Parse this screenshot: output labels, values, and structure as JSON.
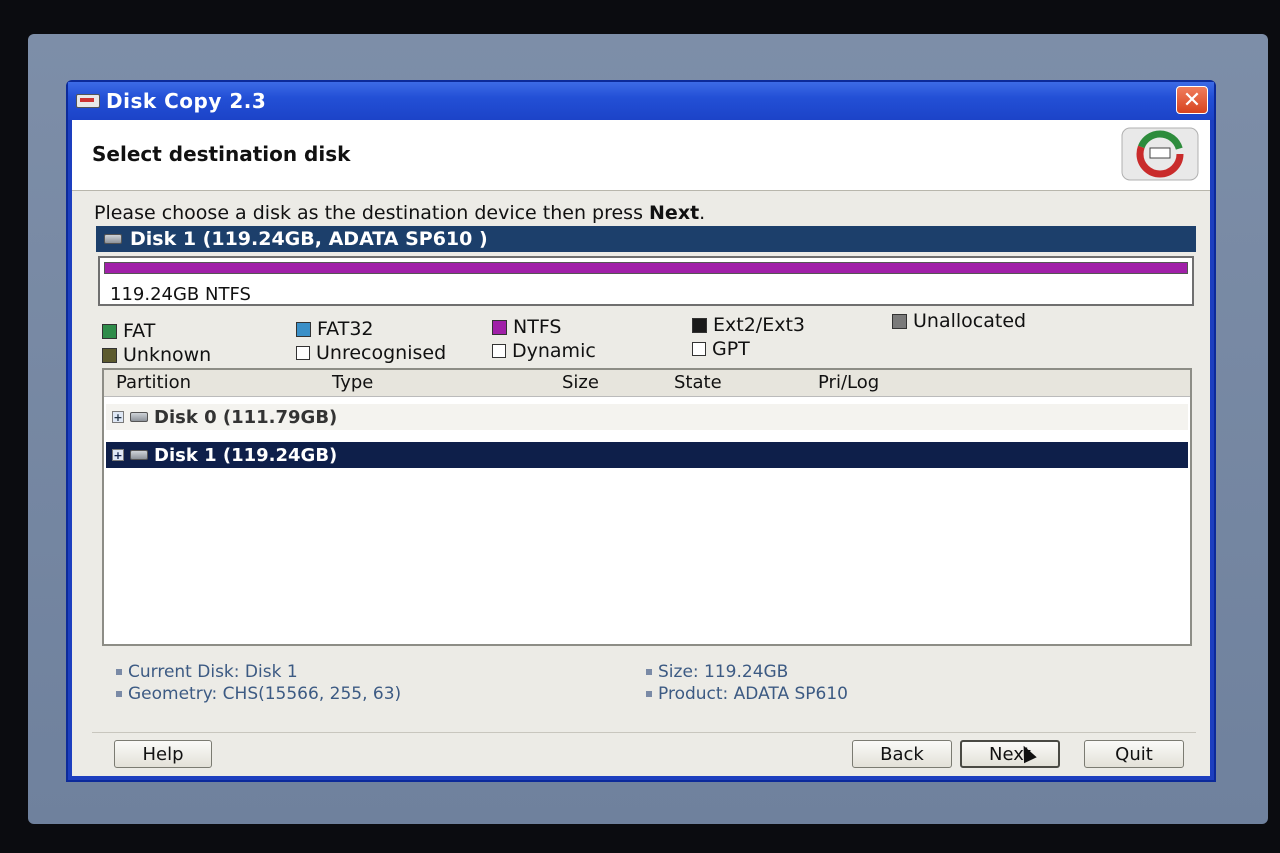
{
  "window": {
    "title": "Disk Copy 2.3",
    "close_glyph": "✕"
  },
  "header": {
    "title": "Select destination disk"
  },
  "instruction": {
    "prefix": "Please choose a disk as the destination device then press ",
    "emphasis": "Next",
    "suffix": "."
  },
  "selected_disk": {
    "label": "Disk 1 (119.24GB, ADATA SP610        )",
    "map_label": "119.24GB NTFS",
    "map_color": "#a020a8"
  },
  "legend": [
    {
      "label": "FAT",
      "color": "#2f8c4a",
      "kind": "swatch"
    },
    {
      "label": "FAT32",
      "color": "#3a8fc7",
      "kind": "swatch"
    },
    {
      "label": "NTFS",
      "color": "#a020a8",
      "kind": "swatch"
    },
    {
      "label": "Ext2/Ext3",
      "color": "#1a1a1a",
      "kind": "swatch"
    },
    {
      "label": "Unallocated",
      "color": "#7a7a7a",
      "kind": "swatch"
    },
    {
      "label": "Unknown",
      "color": "#5c5a2e",
      "kind": "swatch"
    },
    {
      "label": "Unrecognised",
      "kind": "checkbox"
    },
    {
      "label": "Dynamic",
      "kind": "checkbox"
    },
    {
      "label": "GPT",
      "kind": "checkbox"
    }
  ],
  "table": {
    "columns": [
      "Partition",
      "Type",
      "Size",
      "State",
      "Pri/Log"
    ],
    "rows": [
      {
        "label": "Disk 0 (111.79GB)",
        "selected": false
      },
      {
        "label": "Disk 1 (119.24GB)",
        "selected": true
      }
    ]
  },
  "info": {
    "current_disk": "Current Disk: Disk 1",
    "geometry": "Geometry: CHS(15566, 255, 63)",
    "size": "Size: 119.24GB",
    "product": "Product: ADATA SP610"
  },
  "buttons": {
    "help": "Help",
    "back": "Back",
    "next": "Next",
    "quit": "Quit"
  }
}
